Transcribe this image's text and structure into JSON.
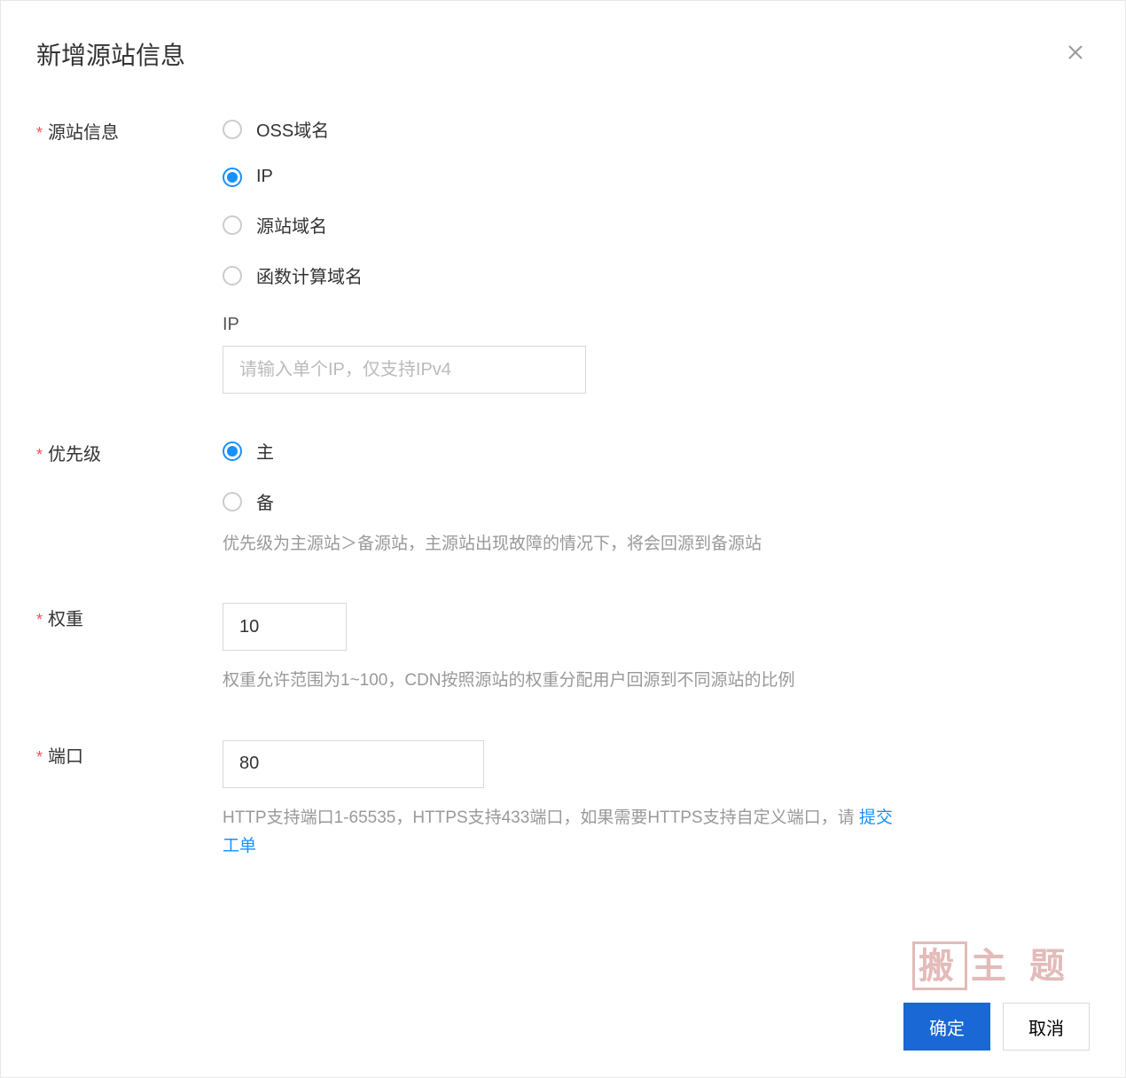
{
  "modal": {
    "title": "新增源站信息"
  },
  "originInfo": {
    "label": "源站信息",
    "options": {
      "oss": "OSS域名",
      "ip": "IP",
      "domain": "源站域名",
      "fc": "函数计算域名"
    },
    "ipSubLabel": "IP",
    "ipPlaceholder": "请输入单个IP，仅支持IPv4"
  },
  "priority": {
    "label": "优先级",
    "options": {
      "primary": "主",
      "backup": "备"
    },
    "help": "优先级为主源站＞备源站，主源站出现故障的情况下，将会回源到备源站"
  },
  "weight": {
    "label": "权重",
    "value": "10",
    "help": "权重允许范围为1~100，CDN按照源站的权重分配用户回源到不同源站的比例"
  },
  "port": {
    "label": "端口",
    "value": "80",
    "helpPrefix": "HTTP支持端口1-65535，HTTPS支持433端口，如果需要HTTPS支持自定义端口，请 ",
    "linkText": "提交工单"
  },
  "footer": {
    "confirm": "确定",
    "cancel": "取消"
  },
  "watermark": {
    "box": "搬",
    "rest": "主 题"
  }
}
